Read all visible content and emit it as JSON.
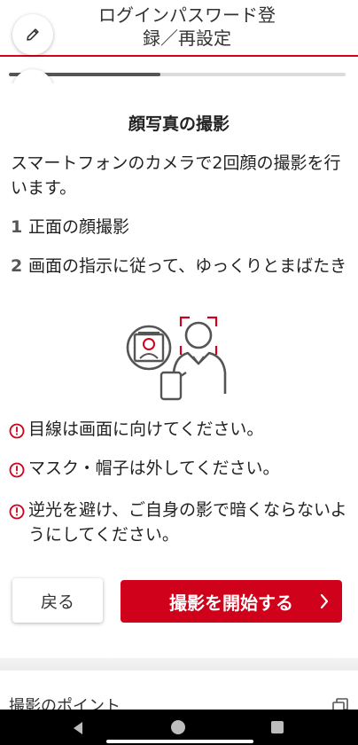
{
  "header": {
    "title_line1": "ログインパスワード登",
    "title_line2": "録／再設定",
    "accent_color": "#d9001b",
    "edit_icon": "pencil-icon",
    "stop_icon": "stop-square-icon"
  },
  "progress": {
    "fraction": 0.45
  },
  "main": {
    "section_title": "顔写真の撮影",
    "intro": "スマートフォンのカメラで2回顔の撮影を行います。",
    "steps": [
      {
        "number": "1",
        "text": "正面の顔撮影"
      },
      {
        "number": "2",
        "text": "画面の指示に従って、ゆっくりとまばたき"
      }
    ],
    "illustration_icon": "face-scan-phone-illustration",
    "warnings": [
      {
        "icon": "exclamation-circle-icon",
        "text": "目線は画面に向けてください。"
      },
      {
        "icon": "exclamation-circle-icon",
        "text": "マスク・帽子は外してください。"
      },
      {
        "icon": "exclamation-circle-icon",
        "text": "逆光を避け、ご自身の影で暗くならないようにしてください。"
      }
    ]
  },
  "buttons": {
    "back_label": "戻る",
    "start_label": "撮影を開始する",
    "start_color": "#d0021b"
  },
  "tips": {
    "label": "撮影のポイント",
    "icon": "copy-icon"
  },
  "system_nav": {
    "back": "nav-back-icon",
    "home": "nav-home-icon",
    "recent": "nav-recent-icon"
  }
}
